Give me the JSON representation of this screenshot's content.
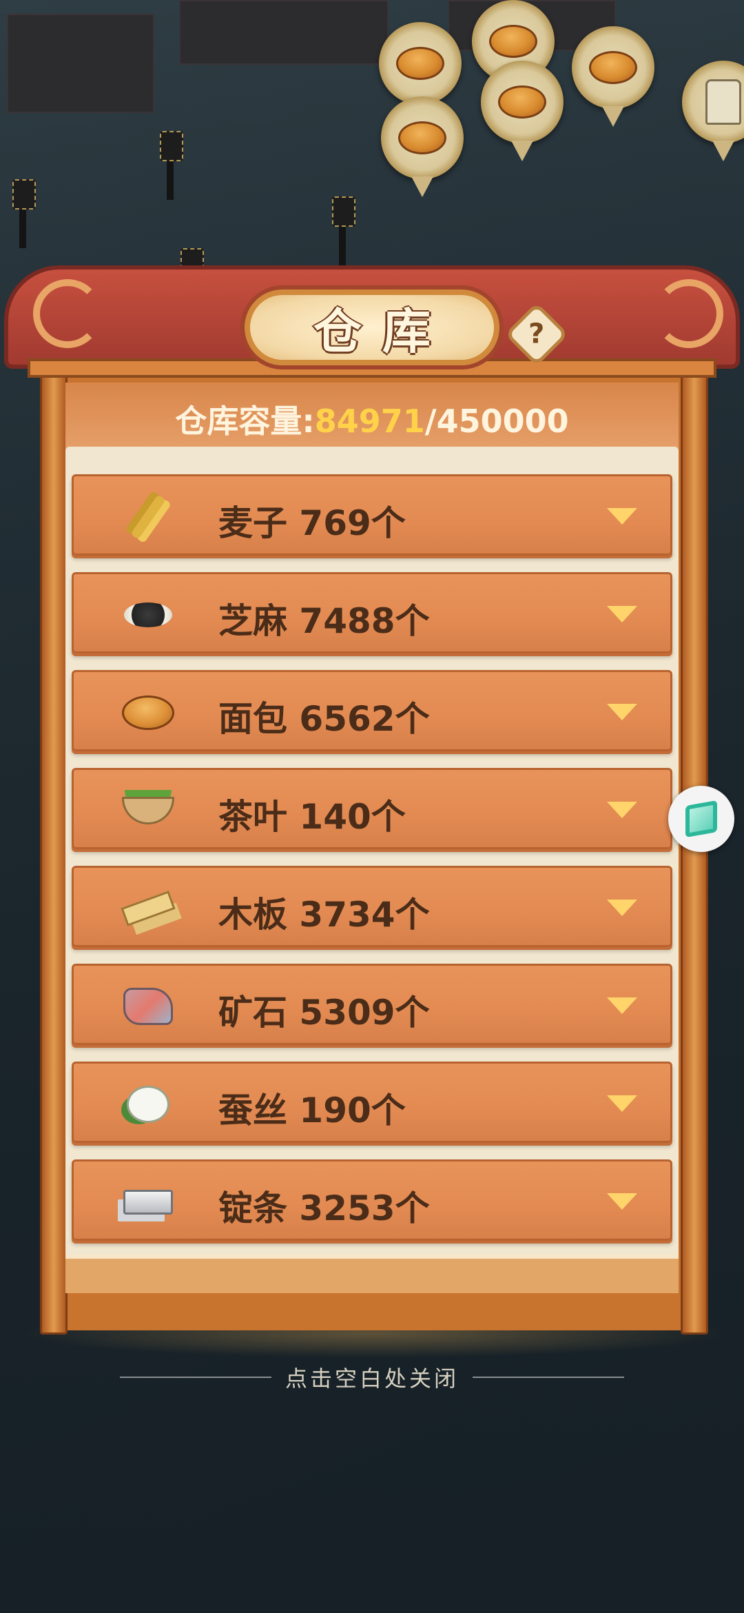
{
  "header": {
    "title": "仓库"
  },
  "capacity": {
    "label": "仓库容量:",
    "used": "84971",
    "separator": "/",
    "total": "450000"
  },
  "items": [
    {
      "name": "麦子",
      "count": "769个",
      "icon": "wheat-icon"
    },
    {
      "name": "芝麻",
      "count": "7488个",
      "icon": "sesame-icon"
    },
    {
      "name": "面包",
      "count": "6562个",
      "icon": "bread-icon"
    },
    {
      "name": "茶叶",
      "count": "140个",
      "icon": "tea-leaves-icon"
    },
    {
      "name": "木板",
      "count": "3734个",
      "icon": "wood-plank-icon"
    },
    {
      "name": "矿石",
      "count": "5309个",
      "icon": "ore-icon"
    },
    {
      "name": "蚕丝",
      "count": "190个",
      "icon": "silk-cocoon-icon"
    },
    {
      "name": "锭条",
      "count": "3253个",
      "icon": "ingot-icon"
    }
  ],
  "close_hint": "点击空白处关闭",
  "colors": {
    "accent": "#ffd24a",
    "row": "#e28a52",
    "roof": "#a13a30"
  }
}
